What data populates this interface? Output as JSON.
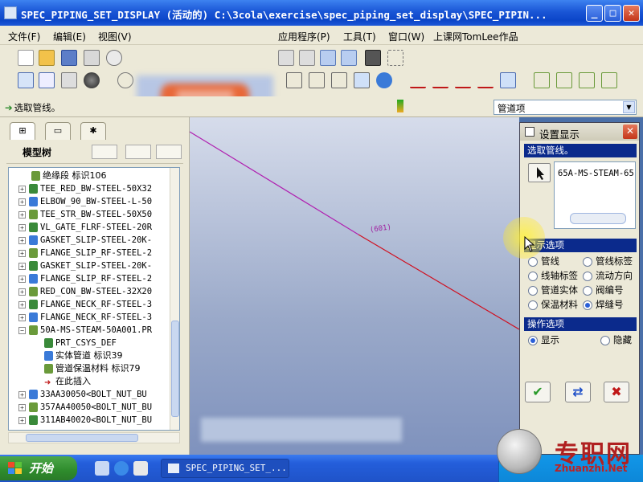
{
  "window": {
    "title": "SPEC_PIPING_SET_DISPLAY (活动的) C:\\3cola\\exercise\\spec_piping_set_display\\SPEC_PIPIN...",
    "minimize": "_",
    "maximize": "□",
    "close": "✕"
  },
  "menubar": {
    "items": [
      "文件(F)",
      "编辑(E)",
      "视图(V)",
      "应用程序(P)",
      "工具(T)",
      "窗口(W)",
      "上课网TomLee作品"
    ]
  },
  "statusbar": {
    "hint": "选取管线。",
    "filter_value": "管道项"
  },
  "model_tree": {
    "title": "模型树",
    "items": [
      {
        "text": "绝缘段 标识106",
        "mono": false,
        "expander": "",
        "indent": 0
      },
      {
        "text": "TEE_RED_BW-STEEL-50X32",
        "mono": true,
        "expander": "+",
        "indent": 0
      },
      {
        "text": "ELBOW_90_BW-STEEL-L-50",
        "mono": true,
        "expander": "+",
        "indent": 0
      },
      {
        "text": "TEE_STR_BW-STEEL-50X50",
        "mono": true,
        "expander": "+",
        "indent": 0
      },
      {
        "text": "VL_GATE_FLRF-STEEL-20R",
        "mono": true,
        "expander": "+",
        "indent": 0
      },
      {
        "text": "GASKET_SLIP-STEEL-20K-",
        "mono": true,
        "expander": "+",
        "indent": 0
      },
      {
        "text": "FLANGE_SLIP_RF-STEEL-2",
        "mono": true,
        "expander": "+",
        "indent": 0
      },
      {
        "text": "GASKET_SLIP-STEEL-20K-",
        "mono": true,
        "expander": "+",
        "indent": 0
      },
      {
        "text": "FLANGE_SLIP_RF-STEEL-2",
        "mono": true,
        "expander": "+",
        "indent": 0
      },
      {
        "text": "RED_CON_BW-STEEL-32X20",
        "mono": true,
        "expander": "+",
        "indent": 0
      },
      {
        "text": "FLANGE_NECK_RF-STEEL-3",
        "mono": true,
        "expander": "+",
        "indent": 0
      },
      {
        "text": "FLANGE_NECK_RF-STEEL-3",
        "mono": true,
        "expander": "+",
        "indent": 0
      },
      {
        "text": "50A-MS-STEAM-50A001.PR",
        "mono": true,
        "expander": "−",
        "indent": 0
      },
      {
        "text": "PRT_CSYS_DEF",
        "mono": true,
        "expander": "",
        "indent": 1
      },
      {
        "text": "实体管道 标识39",
        "mono": false,
        "expander": "",
        "indent": 1
      },
      {
        "text": "管道保温材料 标识79",
        "mono": false,
        "expander": "",
        "indent": 1
      },
      {
        "text": "在此插入",
        "mono": false,
        "expander": "",
        "indent": 1
      },
      {
        "text": "33AA30050<BOLT_NUT_BU",
        "mono": true,
        "expander": "+",
        "indent": 0
      },
      {
        "text": "357AA40050<BOLT_NUT_BU",
        "mono": true,
        "expander": "+",
        "indent": 0
      },
      {
        "text": "311AB40020<BOLT_NUT_BU",
        "mono": true,
        "expander": "+",
        "indent": 0
      }
    ]
  },
  "graphics": {
    "pipe_label": "(601)"
  },
  "dialog": {
    "title": "设置显示",
    "select_section": "选取管线。",
    "selected_pipeline": "65A-MS-STEAM-65",
    "display_section": "显示选项",
    "display_options": [
      {
        "label": "管线",
        "selected": false
      },
      {
        "label": "管线标签",
        "selected": false
      },
      {
        "label": "线轴标签",
        "selected": false
      },
      {
        "label": "流动方向",
        "selected": false
      },
      {
        "label": "管道实体",
        "selected": false
      },
      {
        "label": "阀编号",
        "selected": false
      },
      {
        "label": "保温材料",
        "selected": false
      },
      {
        "label": "焊缝号",
        "selected": true
      }
    ],
    "operation_section": "操作选项",
    "operation_options": [
      {
        "label": "显示",
        "selected": true
      },
      {
        "label": "隐藏",
        "selected": false
      }
    ],
    "ok": "✔",
    "apply": "⇄",
    "cancel": "✖"
  },
  "taskbar": {
    "start_label": "开始",
    "task_label": "SPEC_PIPING_SET_..."
  },
  "watermark": {
    "cn": "专职网",
    "url": "Zhuanzhi.Net"
  },
  "colors": {
    "titlebar": "#0b45c8",
    "dialog_section": "#0b2a8c",
    "pipe_line": "#d01020",
    "pipe_label": "#a020a0"
  }
}
